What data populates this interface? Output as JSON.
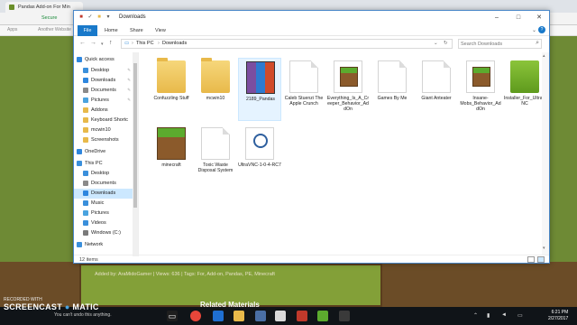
{
  "browser": {
    "tab_title": "Pandas Add-on For Min",
    "secure_label": "Secure",
    "bookmarks": [
      "Apps",
      "Another Website"
    ],
    "added_by": "Added by: AraMidoGamer | Views: 636 | Tags: For, Add-on, Pandas, PE, Minecraft",
    "related": "Related Materials"
  },
  "explorer": {
    "title": "Downloads",
    "ribbon_tabs": [
      "File",
      "Home",
      "Share",
      "View"
    ],
    "address": [
      "This PC",
      "Downloads"
    ],
    "search_placeholder": "Search Downloads",
    "status": "12 items",
    "nav": [
      {
        "label": "Quick access",
        "icon": "star-icon",
        "color": "#2e86de"
      },
      {
        "label": "Desktop",
        "icon": "desktop-icon",
        "color": "#3a8fdb",
        "pinned": true
      },
      {
        "label": "Downloads",
        "icon": "download-icon",
        "color": "#2e86de",
        "pinned": true
      },
      {
        "label": "Documents",
        "icon": "document-icon",
        "color": "#8a8a8a",
        "pinned": true
      },
      {
        "label": "Pictures",
        "icon": "picture-icon",
        "color": "#4aa3df",
        "pinned": true
      },
      {
        "label": "Addons",
        "icon": "folder-icon",
        "color": "#e8b94a"
      },
      {
        "label": "Keyboard Shortc",
        "icon": "folder-icon",
        "color": "#e8b94a"
      },
      {
        "label": "mcwin10",
        "icon": "folder-icon",
        "color": "#e8b94a"
      },
      {
        "label": "Screenshots",
        "icon": "folder-icon",
        "color": "#e8b94a"
      },
      {
        "label": "OneDrive",
        "icon": "cloud-icon",
        "color": "#2e86de"
      },
      {
        "label": "This PC",
        "icon": "computer-icon",
        "color": "#3a8fdb"
      },
      {
        "label": "Desktop",
        "icon": "desktop-icon",
        "color": "#3a8fdb"
      },
      {
        "label": "Documents",
        "icon": "document-icon",
        "color": "#8a8a8a"
      },
      {
        "label": "Downloads",
        "icon": "download-icon",
        "color": "#2e86de",
        "selected": true
      },
      {
        "label": "Music",
        "icon": "music-icon",
        "color": "#3a8fdb"
      },
      {
        "label": "Pictures",
        "icon": "picture-icon",
        "color": "#4aa3df"
      },
      {
        "label": "Videos",
        "icon": "video-icon",
        "color": "#3a8fdb"
      },
      {
        "label": "Windows (C:)",
        "icon": "drive-icon",
        "color": "#7a7a7a"
      },
      {
        "label": "Network",
        "icon": "network-icon",
        "color": "#3a8fdb"
      }
    ],
    "files": [
      {
        "name": "Confuzzling Stuff",
        "kind": "folder"
      },
      {
        "name": "mcwin10",
        "kind": "folder"
      },
      {
        "name": "2189_Pandas",
        "kind": "archive",
        "selected": true
      },
      {
        "name": "Caleb Stuenzi The Apple Crunch",
        "kind": "blank"
      },
      {
        "name": "Everything_Is_A_Creeper_Behavior_AddOn",
        "kind": "grass"
      },
      {
        "name": "Games By Me",
        "kind": "blank"
      },
      {
        "name": "Giant Anteater",
        "kind": "blank"
      },
      {
        "name": "Insane-Mobs_Behavior_AddOn",
        "kind": "grass"
      },
      {
        "name": "Installer_For_UltraVNC",
        "kind": "vnc"
      },
      {
        "name": "minecraft",
        "kind": "grass-big"
      },
      {
        "name": "Toxic Waste Disposal System",
        "kind": "blank"
      },
      {
        "name": "UltraVNC-1-0-4-RC7",
        "kind": "vnc-app"
      }
    ]
  },
  "taskbar": {
    "time": "6:21 PM",
    "date": "2/27/2017"
  },
  "watermark": {
    "recorded": "RECORDED WITH",
    "brand": "SCREENCAST",
    "brand2": "MATIC",
    "sub": "You can't undo this anything."
  }
}
